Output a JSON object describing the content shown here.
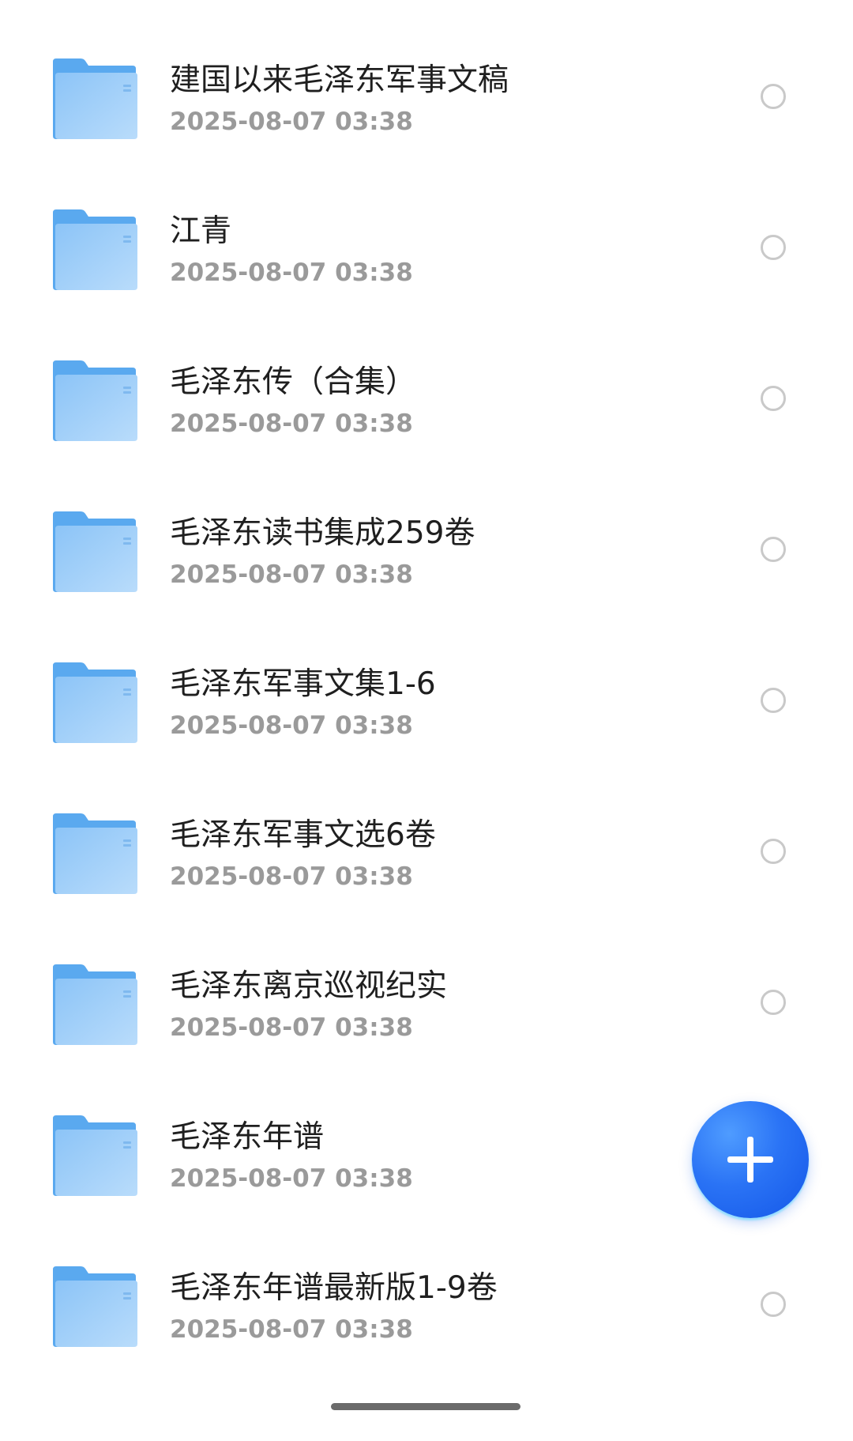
{
  "files": [
    {
      "name": "建国以来毛泽东军事文稿",
      "date": "2025-08-07 03:38",
      "icon": "folder-icon"
    },
    {
      "name": "江青",
      "date": "2025-08-07 03:38",
      "icon": "folder-icon"
    },
    {
      "name": "毛泽东传（合集）",
      "date": "2025-08-07 03:38",
      "icon": "folder-icon"
    },
    {
      "name": "毛泽东读书集成259卷",
      "date": "2025-08-07 03:38",
      "icon": "folder-icon"
    },
    {
      "name": "毛泽东军事文集1-6",
      "date": "2025-08-07 03:38",
      "icon": "folder-icon"
    },
    {
      "name": "毛泽东军事文选6卷",
      "date": "2025-08-07 03:38",
      "icon": "folder-icon"
    },
    {
      "name": "毛泽东离京巡视纪实",
      "date": "2025-08-07 03:38",
      "icon": "folder-icon"
    },
    {
      "name": "毛泽东年谱",
      "date": "2025-08-07 03:38",
      "icon": "folder-icon"
    },
    {
      "name": "毛泽东年谱最新版1-9卷",
      "date": "2025-08-07 03:38",
      "icon": "folder-icon"
    }
  ],
  "fab": {
    "icon": "plus-icon",
    "color": "#1f6ef2"
  },
  "colors": {
    "folder_back": "#5aa9ef",
    "folder_front": "#a9d4fa",
    "name_text": "#1f1f1f",
    "date_text": "#9a9a9a",
    "radio_border": "#c9c9c9"
  }
}
